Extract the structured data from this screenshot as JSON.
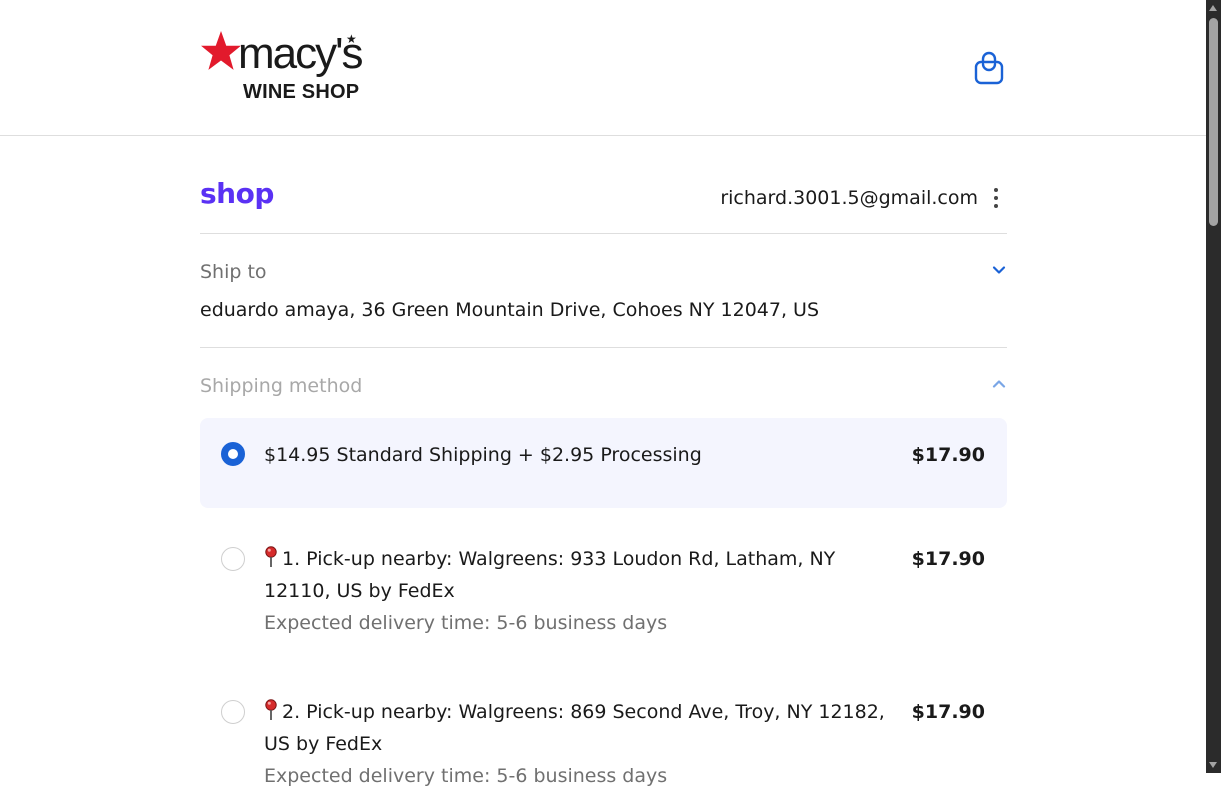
{
  "header": {
    "logo_text": "macy's",
    "logo_subtitle": "WINE SHOP",
    "cart_icon": "shopping-bag-icon"
  },
  "account": {
    "shop_logo": "shop",
    "email": "richard.3001.5@gmail.com",
    "menu_icon": "kebab-menu-icon"
  },
  "ship_to": {
    "title": "Ship to",
    "address": "eduardo amaya, 36 Green Mountain Drive, Cohoes NY 12047, US",
    "toggle_icon": "chevron-down-icon"
  },
  "shipping_method": {
    "title": "Shipping method",
    "toggle_icon": "chevron-up-icon",
    "options": [
      {
        "label": "$14.95 Standard Shipping + $2.95 Processing",
        "price": "$17.90",
        "selected": true
      },
      {
        "label": "1. Pick-up nearby: Walgreens: 933 Loudon Rd, Latham, NY 12110, US by FedEx",
        "sublabel": "Expected delivery time: 5-6 business days",
        "price": "$17.90",
        "selected": false,
        "icon": "map-pin-icon"
      },
      {
        "label": "2. Pick-up nearby: Walgreens: 869 Second Ave, Troy, NY 12182, US by FedEx",
        "sublabel": "Expected delivery time: 5-6 business days",
        "price": "$17.90",
        "selected": false,
        "icon": "map-pin-icon"
      }
    ]
  },
  "colors": {
    "shop_brand": "#5a31f4",
    "macys_red": "#e21a2c",
    "radio_selected": "#1a62d6",
    "selected_bg": "#f4f5fe",
    "chevron": "#1a62d6"
  }
}
